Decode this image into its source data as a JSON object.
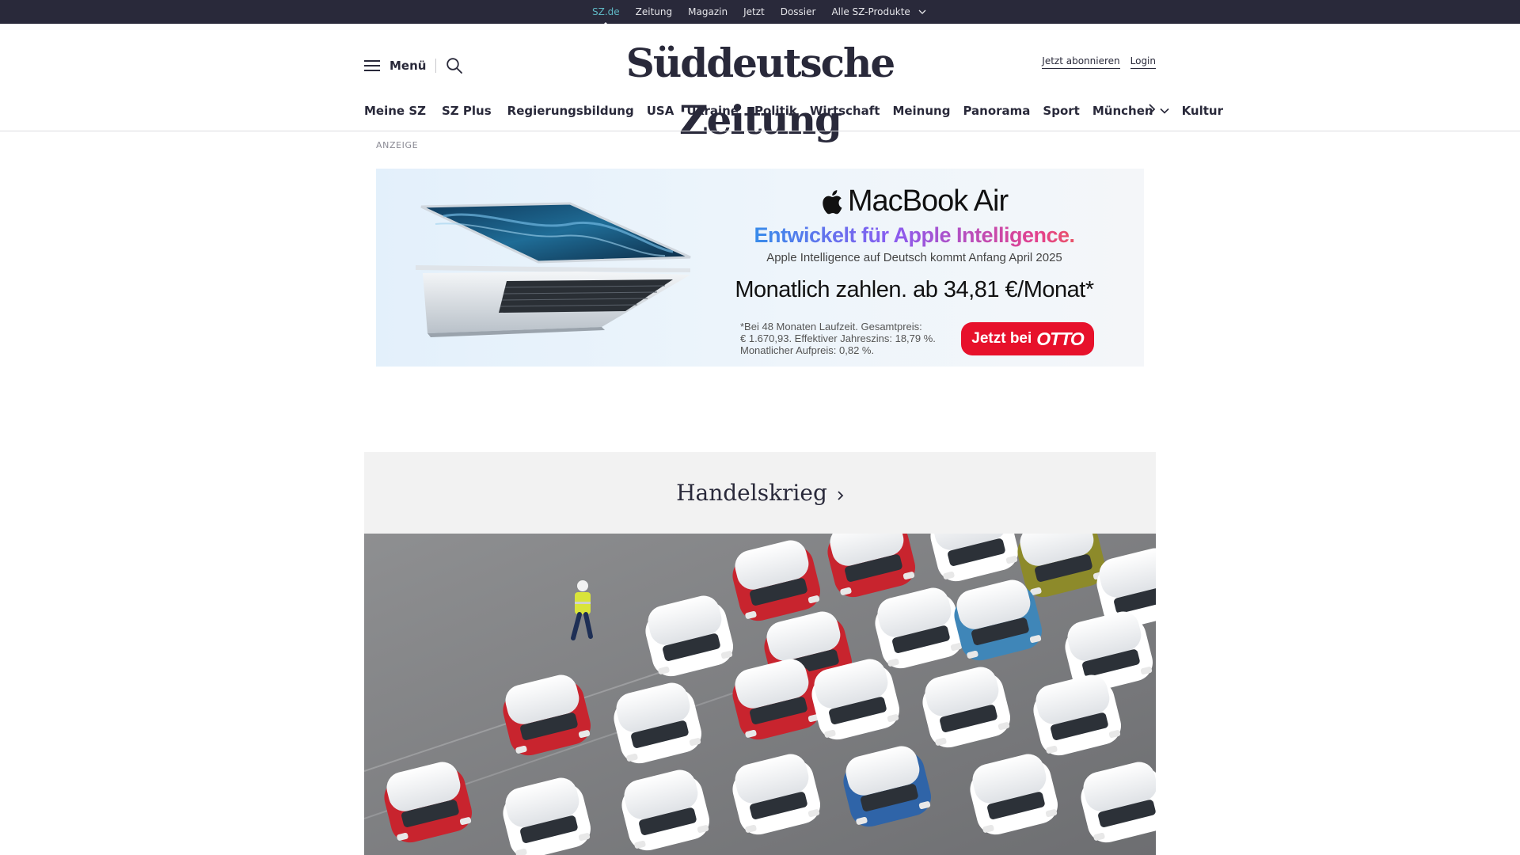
{
  "topbar": {
    "items": [
      "SZ.de",
      "Zeitung",
      "Magazin",
      "Jetzt",
      "Dossier",
      "Alle SZ-Produkte"
    ],
    "active_index": 0
  },
  "header": {
    "menu_label": "Menü",
    "logo": "Süddeutsche Zeitung",
    "subscribe_label": "Jetzt abonnieren",
    "login_label": "Login"
  },
  "nav": {
    "items": [
      "Meine SZ",
      "SZ Plus",
      "Regierungsbildung",
      "USA",
      "Ukraine",
      "Politik",
      "Wirtschaft",
      "Meinung",
      "Panorama",
      "Sport",
      "München",
      "Kultur"
    ]
  },
  "ad": {
    "label": "ANZEIGE",
    "product": "MacBook Air",
    "headline": "Entwickelt für Apple Intelligence.",
    "subline": "Apple Intelligence auf Deutsch kommt Anfang April 2025",
    "price_line": "Monatlich zahlen. ab 34,81 €/Monat*",
    "fine_print": [
      "*Bei 48 Monaten Laufzeit. Gesamtpreis:",
      "€ 1.670,93. Effektiver Jahreszins: 18,79 %.",
      "Monatlicher Aufpreis: 0,82 %."
    ],
    "cta_prefix": "Jetzt bei",
    "cta_brand": "OTTO"
  },
  "topic": {
    "title": "Handelskrieg"
  },
  "colors": {
    "topbar_bg": "#29293a",
    "accent": "#5fb8c4",
    "ad_cta": "#e7112b",
    "topic_bg": "#f2f2f2"
  },
  "icons": [
    "hamburger-icon",
    "search-icon",
    "chevron-down-icon",
    "chevron-right-icon",
    "apple-logo-icon"
  ]
}
